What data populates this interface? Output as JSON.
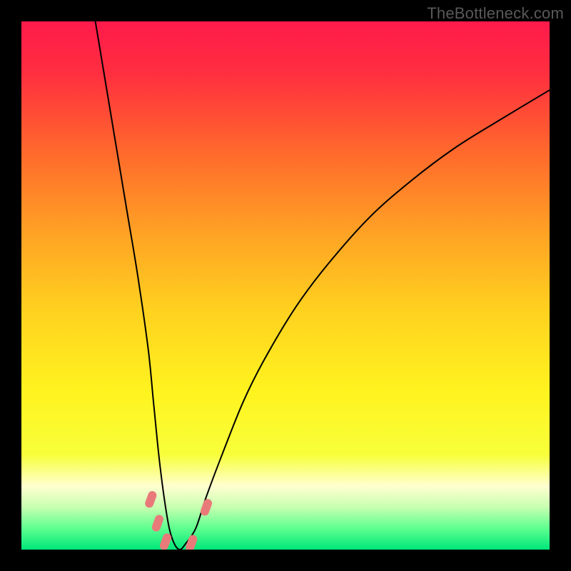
{
  "watermark": "TheBottleneck.com",
  "chart_data": {
    "type": "line",
    "title": "",
    "xlabel": "",
    "ylabel": "",
    "xlim": [
      0,
      100
    ],
    "ylim": [
      0,
      100
    ],
    "grid": false,
    "legend": false,
    "background_gradient_stops": [
      {
        "offset": 0.0,
        "color": "#ff1a4b"
      },
      {
        "offset": 0.1,
        "color": "#ff2f3f"
      },
      {
        "offset": 0.25,
        "color": "#ff6a2c"
      },
      {
        "offset": 0.4,
        "color": "#ffa224"
      },
      {
        "offset": 0.55,
        "color": "#ffd21f"
      },
      {
        "offset": 0.7,
        "color": "#fff31f"
      },
      {
        "offset": 0.82,
        "color": "#f7ff3a"
      },
      {
        "offset": 0.88,
        "color": "#ffffd0"
      },
      {
        "offset": 0.92,
        "color": "#c6ffb0"
      },
      {
        "offset": 0.96,
        "color": "#5dff8f"
      },
      {
        "offset": 1.0,
        "color": "#00e77a"
      }
    ],
    "series": [
      {
        "name": "bottleneck-curve",
        "stroke": "#000000",
        "stroke_width": 2,
        "x": [
          14,
          16,
          18,
          20,
          22,
          24,
          25,
          26,
          27,
          28,
          29,
          30,
          31,
          33,
          35,
          38,
          42,
          46,
          52,
          58,
          66,
          74,
          82,
          90,
          100
        ],
        "y": [
          100,
          88,
          76,
          64,
          52,
          38,
          28,
          18,
          10,
          4,
          1,
          0,
          1,
          4,
          10,
          18,
          28,
          36,
          46,
          54,
          63,
          70,
          76,
          81,
          87
        ]
      }
    ],
    "markers": [
      {
        "name": "marker-left-upper",
        "x": 24.5,
        "y": 9.5,
        "color": "#e97a7a"
      },
      {
        "name": "marker-left-mid",
        "x": 25.8,
        "y": 5.0,
        "color": "#e97a7a"
      },
      {
        "name": "marker-left-lower",
        "x": 27.3,
        "y": 1.5,
        "color": "#e97a7a"
      },
      {
        "name": "marker-bottom-right",
        "x": 32.2,
        "y": 1.2,
        "color": "#e97a7a"
      },
      {
        "name": "marker-right-upper",
        "x": 35.0,
        "y": 8.0,
        "color": "#e97a7a"
      }
    ],
    "marker_style": {
      "rx": 6,
      "ry": 12,
      "rotation_deg": 20
    }
  }
}
